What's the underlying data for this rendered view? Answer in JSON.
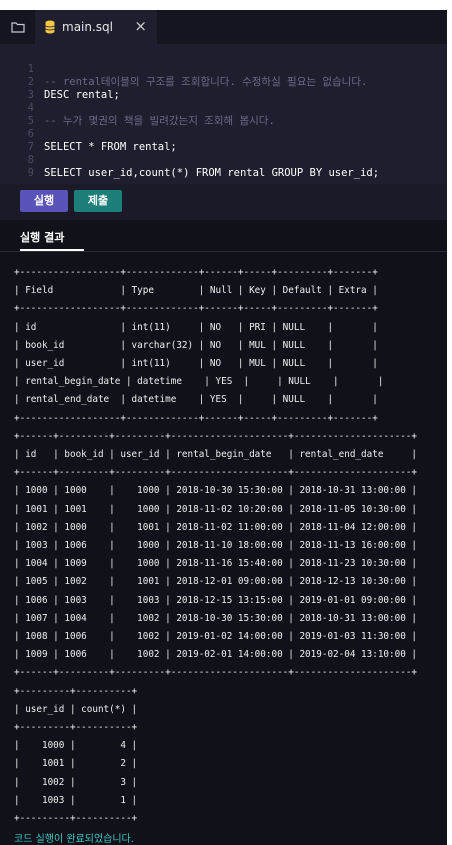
{
  "tab": {
    "filename": "main.sql",
    "icons": [
      "folder-icon",
      "database-icon",
      "close-icon"
    ]
  },
  "editor": {
    "lines": [
      {
        "num": "1",
        "text": "-- rental테이블의 구조를 조회합니다. 수정하실 필요는 없습니다."
      },
      {
        "num": "2",
        "text": "DESC rental;"
      },
      {
        "num": "3",
        "text": ""
      },
      {
        "num": "4",
        "text": "-- 누가 몇권의 책을 빌려갔는지 조회해 봅시다."
      },
      {
        "num": "5",
        "text": ""
      },
      {
        "num": "6",
        "text": "SELECT * FROM rental;"
      },
      {
        "num": "7",
        "text": ""
      },
      {
        "num": "8",
        "text": "SELECT user_id,count(*) FROM rental GROUP BY user_id;"
      },
      {
        "num": "9",
        "text": ""
      }
    ]
  },
  "buttons": {
    "run": "실행",
    "submit": "제출"
  },
  "results": {
    "tab_label": "실행 결과",
    "output": "+------------------+-------------+------+-----+---------+-------+\n| Field            | Type        | Null | Key | Default | Extra |\n+------------------+-------------+------+-----+---------+-------+\n| id               | int(11)     | NO   | PRI | NULL    |       |\n| book_id          | varchar(32) | NO   | MUL | NULL    |       |\n| user_id          | int(11)     | NO   | MUL | NULL    |       |\n| rental_begin_date | datetime    | YES  |     | NULL    |       |\n| rental_end_date  | datetime    | YES  |     | NULL    |       |\n+------------------+-------------+------+-----+---------+-------+\n+------+---------+---------+---------------------+---------------------+\n| id   | book_id | user_id | rental_begin_date   | rental_end_date     |\n+------+---------+---------+---------------------+---------------------+\n| 1000 | 1000    |    1000 | 2018-10-30 15:30:00 | 2018-10-31 13:00:00 |\n| 1001 | 1001    |    1000 | 2018-11-02 10:20:00 | 2018-11-05 10:30:00 |\n| 1002 | 1000    |    1001 | 2018-11-02 11:00:00 | 2018-11-04 12:00:00 |\n| 1003 | 1006    |    1000 | 2018-11-10 18:00:00 | 2018-11-13 16:00:00 |\n| 1004 | 1009    |    1000 | 2018-11-16 15:40:00 | 2018-11-23 10:30:00 |\n| 1005 | 1002    |    1001 | 2018-12-01 09:00:00 | 2018-12-13 10:30:00 |\n| 1006 | 1003    |    1003 | 2018-12-15 13:15:00 | 2019-01-01 09:00:00 |\n| 1007 | 1004    |    1002 | 2018-10-30 15:30:00 | 2018-10-31 13:00:00 |\n| 1008 | 1006    |    1002 | 2019-01-02 14:00:00 | 2019-01-03 11:30:00 |\n| 1009 | 1006    |    1002 | 2019-02-01 14:00:00 | 2019-02-04 13:10:00 |\n+------+---------+---------+---------------------+---------------------+\n+---------+----------+\n| user_id | count(*) |\n+---------+----------+\n|    1000 |        4 |\n|    1001 |        2 |\n|    1002 |        3 |\n|    1003 |        1 |\n+---------+----------+",
    "status": "코드 실행이 완료되었습니다."
  }
}
